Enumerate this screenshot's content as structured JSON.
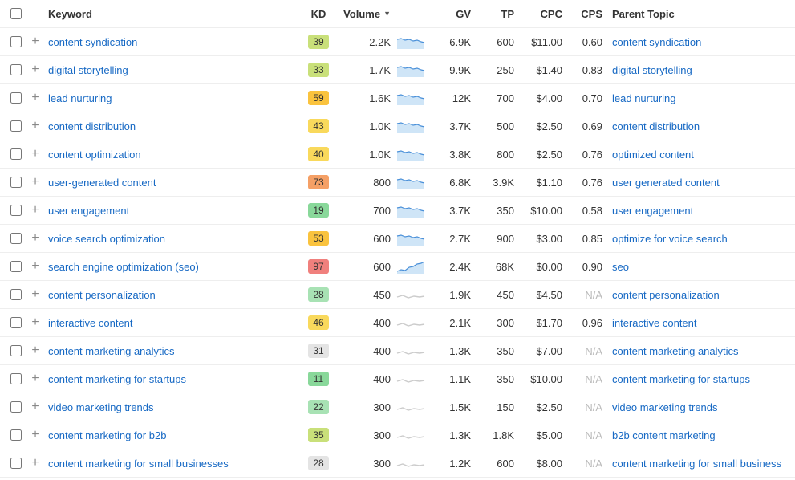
{
  "headers": {
    "keyword": "Keyword",
    "kd": "KD",
    "volume": "Volume",
    "gv": "GV",
    "tp": "TP",
    "cpc": "CPC",
    "cps": "CPS",
    "parent": "Parent Topic"
  },
  "rows": [
    {
      "keyword": "content syndication",
      "kd": 39,
      "kd_color": "#c9e07a",
      "volume": "2.2K",
      "spark": "blue",
      "gv": "6.9K",
      "tp": "600",
      "cpc": "$11.00",
      "cps": "0.60",
      "parent": "content syndication"
    },
    {
      "keyword": "digital storytelling",
      "kd": 33,
      "kd_color": "#c9e07a",
      "volume": "1.7K",
      "spark": "blue",
      "gv": "9.9K",
      "tp": "250",
      "cpc": "$1.40",
      "cps": "0.83",
      "parent": "digital storytelling"
    },
    {
      "keyword": "lead nurturing",
      "kd": 59,
      "kd_color": "#fac33e",
      "volume": "1.6K",
      "spark": "blue",
      "gv": "12K",
      "tp": "700",
      "cpc": "$4.00",
      "cps": "0.70",
      "parent": "lead nurturing"
    },
    {
      "keyword": "content distribution",
      "kd": 43,
      "kd_color": "#f9d95c",
      "volume": "1.0K",
      "spark": "blue",
      "gv": "3.7K",
      "tp": "500",
      "cpc": "$2.50",
      "cps": "0.69",
      "parent": "content distribution"
    },
    {
      "keyword": "content optimization",
      "kd": 40,
      "kd_color": "#f9d95c",
      "volume": "1.0K",
      "spark": "blue",
      "gv": "3.8K",
      "tp": "800",
      "cpc": "$2.50",
      "cps": "0.76",
      "parent": "optimized content"
    },
    {
      "keyword": "user-generated content",
      "kd": 73,
      "kd_color": "#f5a066",
      "volume": "800",
      "spark": "blue",
      "gv": "6.8K",
      "tp": "3.9K",
      "cpc": "$1.10",
      "cps": "0.76",
      "parent": "user generated content"
    },
    {
      "keyword": "user engagement",
      "kd": 19,
      "kd_color": "#89d89a",
      "volume": "700",
      "spark": "blue",
      "gv": "3.7K",
      "tp": "350",
      "cpc": "$10.00",
      "cps": "0.58",
      "parent": "user engagement"
    },
    {
      "keyword": "voice search optimization",
      "kd": 53,
      "kd_color": "#fac33e",
      "volume": "600",
      "spark": "blue",
      "gv": "2.7K",
      "tp": "900",
      "cpc": "$3.00",
      "cps": "0.85",
      "parent": "optimize for voice search"
    },
    {
      "keyword": "search engine optimization (seo)",
      "kd": 97,
      "kd_color": "#f0807d",
      "volume": "600",
      "spark": "blue-up",
      "gv": "2.4K",
      "tp": "68K",
      "cpc": "$0.00",
      "cps": "0.90",
      "parent": "seo"
    },
    {
      "keyword": "content personalization",
      "kd": 28,
      "kd_color": "#a8e2b4",
      "volume": "450",
      "spark": "gray",
      "gv": "1.9K",
      "tp": "450",
      "cpc": "$4.50",
      "cps": "N/A",
      "parent": "content personalization"
    },
    {
      "keyword": "interactive content",
      "kd": 46,
      "kd_color": "#f9d95c",
      "volume": "400",
      "spark": "gray",
      "gv": "2.1K",
      "tp": "300",
      "cpc": "$1.70",
      "cps": "0.96",
      "parent": "interactive content"
    },
    {
      "keyword": "content marketing analytics",
      "kd": 31,
      "kd_color": "#e4e4e4",
      "volume": "400",
      "spark": "gray",
      "gv": "1.3K",
      "tp": "350",
      "cpc": "$7.00",
      "cps": "N/A",
      "parent": "content marketing analytics"
    },
    {
      "keyword": "content marketing for startups",
      "kd": 11,
      "kd_color": "#89d89a",
      "volume": "400",
      "spark": "gray",
      "gv": "1.1K",
      "tp": "350",
      "cpc": "$10.00",
      "cps": "N/A",
      "parent": "content marketing for startups"
    },
    {
      "keyword": "video marketing trends",
      "kd": 22,
      "kd_color": "#a8e2b4",
      "volume": "300",
      "spark": "gray",
      "gv": "1.5K",
      "tp": "150",
      "cpc": "$2.50",
      "cps": "N/A",
      "parent": "video marketing trends"
    },
    {
      "keyword": "content marketing for b2b",
      "kd": 35,
      "kd_color": "#c9e07a",
      "volume": "300",
      "spark": "gray",
      "gv": "1.3K",
      "tp": "1.8K",
      "cpc": "$5.00",
      "cps": "N/A",
      "parent": "b2b content marketing"
    },
    {
      "keyword": "content marketing for small businesses",
      "kd": 28,
      "kd_color": "#e4e4e4",
      "volume": "300",
      "spark": "gray",
      "gv": "1.2K",
      "tp": "600",
      "cpc": "$8.00",
      "cps": "N/A",
      "parent": "content marketing for small business"
    }
  ]
}
